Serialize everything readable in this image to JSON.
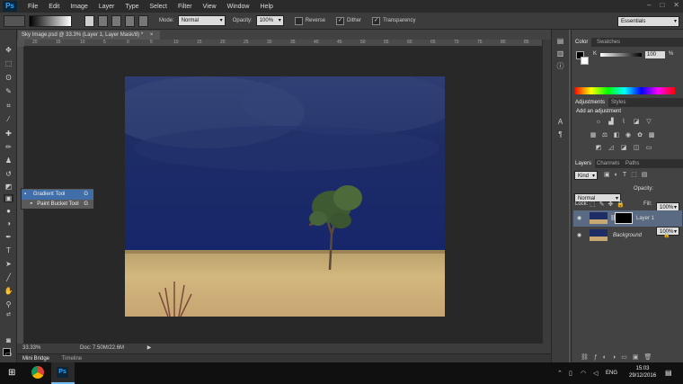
{
  "app": {
    "logo": "Ps"
  },
  "menu": [
    "File",
    "Edit",
    "Image",
    "Layer",
    "Type",
    "Select",
    "Filter",
    "View",
    "Window",
    "Help"
  ],
  "window_controls": [
    "–",
    "□",
    "✕"
  ],
  "options": {
    "mode_label": "Mode:",
    "mode_value": "Normal",
    "opacity_label": "Opacity:",
    "opacity_value": "100%",
    "reverse_label": "Reverse",
    "dither_label": "Dither",
    "transparency_label": "Transparency",
    "workspace": "Essentials"
  },
  "document": {
    "tab": "Sky Image.psd @ 33.3% (Layer 1, Layer Mask/8) *",
    "tab_close": "×"
  },
  "rulers": [
    "20",
    "15",
    "10",
    "5",
    "0",
    "5",
    "10",
    "15",
    "20",
    "25",
    "30",
    "35",
    "40",
    "45",
    "50",
    "55",
    "60",
    "65",
    "70",
    "75",
    "80",
    "85"
  ],
  "flyout": [
    {
      "label": "Gradient Tool",
      "key": "G"
    },
    {
      "label": "Paint Bucket Tool",
      "key": "G"
    }
  ],
  "status": {
    "zoom": "33.33%",
    "doc": "Doc: 7.50M/22.6M"
  },
  "bottom_tabs": {
    "mini_bridge": "Mini Bridge",
    "timeline": "Timeline"
  },
  "color_panel": {
    "tabs": [
      "Color",
      "Swatches"
    ],
    "channel": "K",
    "value": "100",
    "unit": "%"
  },
  "adjustments_panel": {
    "tabs": [
      "Adjustments",
      "Styles"
    ],
    "heading": "Add an adjustment"
  },
  "layers_panel": {
    "tabs": [
      "Layers",
      "Channels",
      "Paths"
    ],
    "kind": "Kind",
    "blend": "Normal",
    "opacity_label": "Opacity:",
    "opacity_value": "100%",
    "lock_label": "Lock:",
    "fill_label": "Fill:",
    "fill_value": "100%",
    "layers": [
      "Layer 1",
      "Background"
    ]
  },
  "taskbar": {
    "lang": "ENG",
    "time": "15:03",
    "date": "29/12/2016"
  },
  "colors": {
    "accent": "#3f6ea8",
    "sky": "#1c2f6b",
    "grass": "#c8a870"
  }
}
